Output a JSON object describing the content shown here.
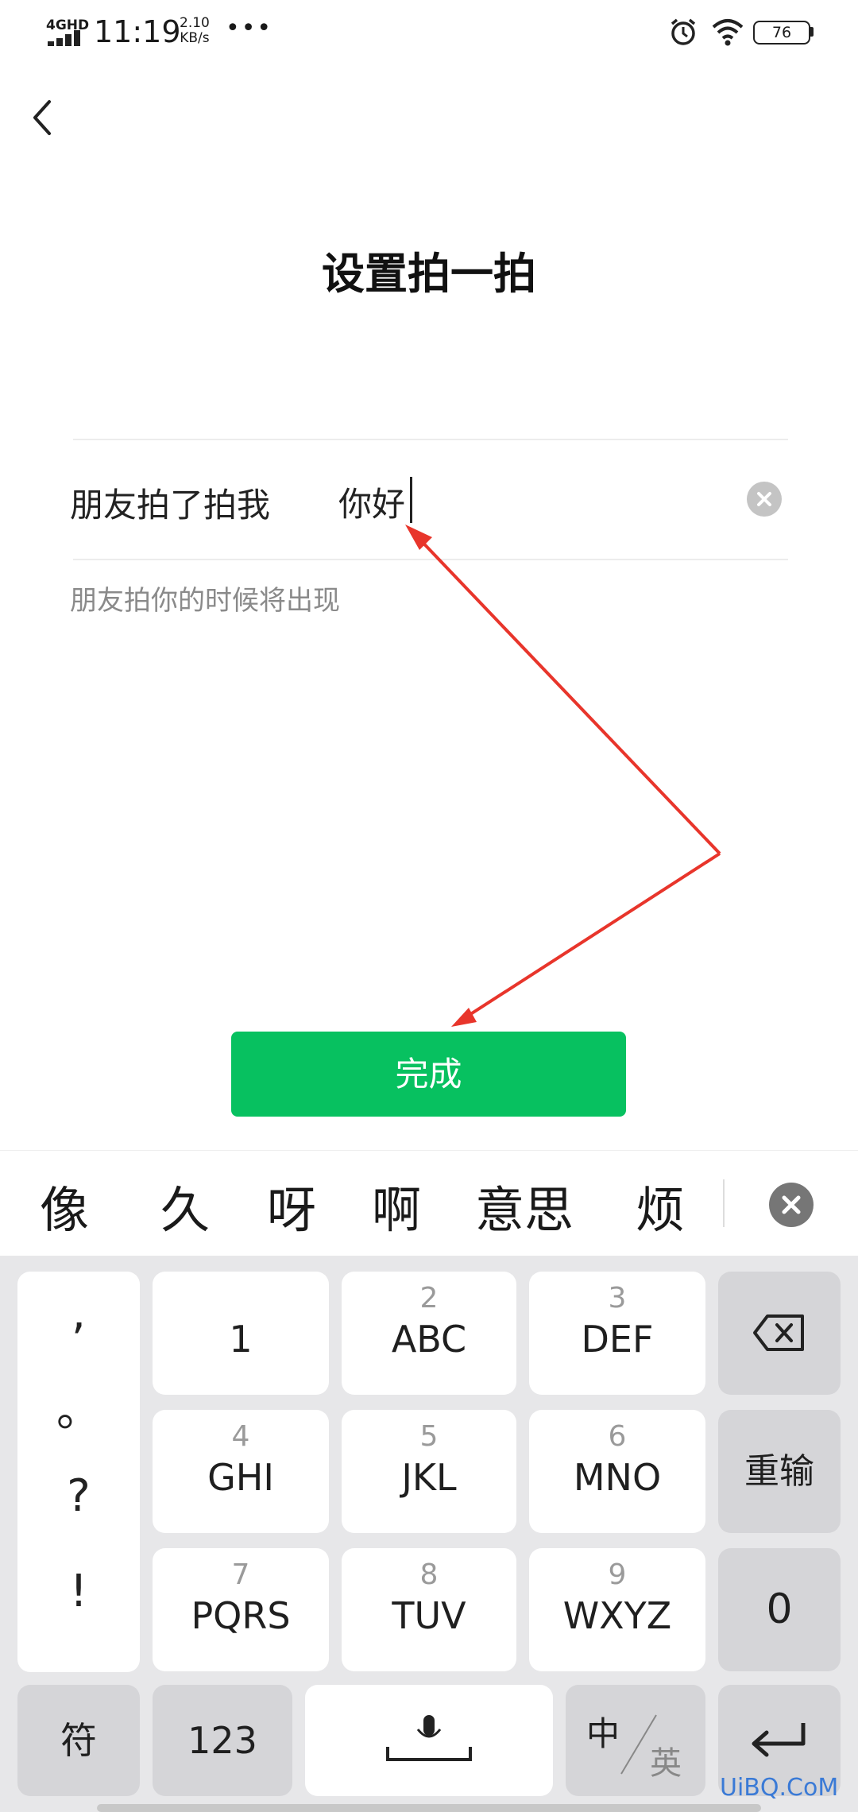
{
  "status_bar": {
    "network": "4GHD",
    "time": "11:19",
    "speed_value": "2.10",
    "speed_unit": "KB/s",
    "more": "•••",
    "battery": "76"
  },
  "page": {
    "title": "设置拍一拍",
    "prefix_label": "朋友拍了拍我",
    "input_value": "你好",
    "hint": "朋友拍你的时候将出现",
    "done_label": "完成"
  },
  "candidates": [
    "像",
    "久",
    "呀",
    "啊",
    "意思",
    "烦"
  ],
  "keyboard": {
    "punctuation": [
      ",",
      "。",
      "?",
      "!"
    ],
    "keys": [
      {
        "num": "",
        "letters": "1"
      },
      {
        "num": "2",
        "letters": "ABC"
      },
      {
        "num": "3",
        "letters": "DEF"
      },
      {
        "num": "4",
        "letters": "GHI"
      },
      {
        "num": "5",
        "letters": "JKL"
      },
      {
        "num": "6",
        "letters": "MNO"
      },
      {
        "num": "7",
        "letters": "PQRS"
      },
      {
        "num": "8",
        "letters": "TUV"
      },
      {
        "num": "9",
        "letters": "WXYZ"
      }
    ],
    "retype": "重输",
    "zero": "0",
    "symbols": "符",
    "numbers": "123",
    "lang_zh": "中",
    "lang_en": "英"
  },
  "watermark": "UiBQ.CoM",
  "colors": {
    "accent": "#07c160",
    "arrow": "#e8352b"
  },
  "icons": [
    "back-arrow-icon",
    "clear-icon",
    "backspace-icon",
    "microphone-icon",
    "enter-icon",
    "alarm-icon",
    "wifi-icon",
    "battery-icon",
    "signal-icon"
  ]
}
